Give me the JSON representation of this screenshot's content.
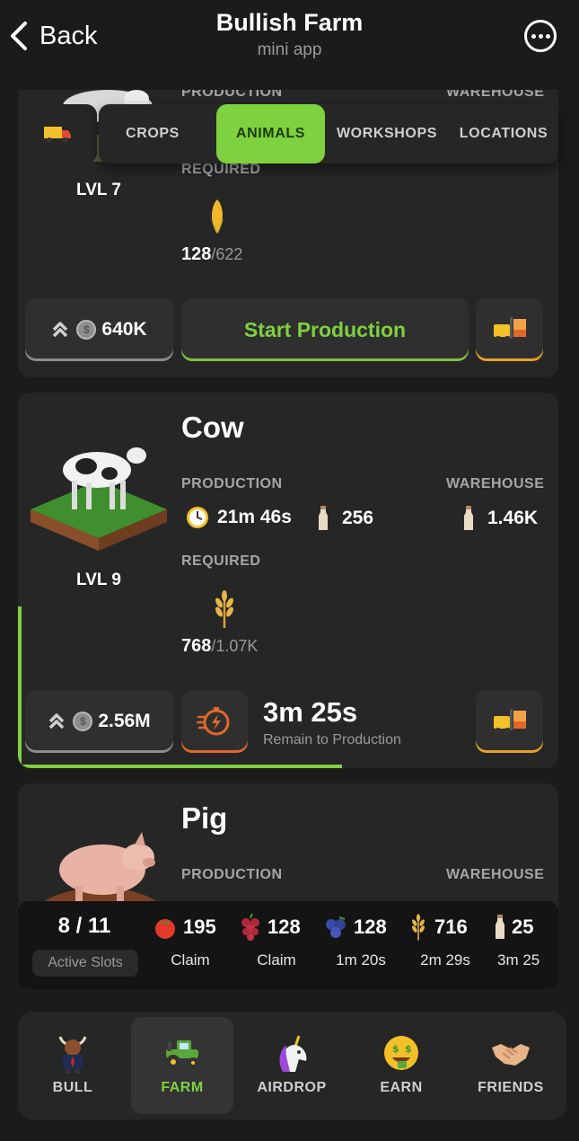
{
  "header": {
    "back_label": "Back",
    "title": "Bullish Farm",
    "subtitle": "mini app"
  },
  "tabs": [
    {
      "label": "CROPS",
      "active": false
    },
    {
      "label": "ANIMALS",
      "active": true
    },
    {
      "label": "WORKSHOPS",
      "active": false
    },
    {
      "label": "LOCATIONS",
      "active": false
    }
  ],
  "cards": [
    {
      "name": "",
      "level": "LVL 7",
      "production_label": "PRODUCTION",
      "warehouse_label": "WAREHOUSE",
      "required_label": "REQUIRED",
      "required_icon": "corn-icon",
      "required_have": "128",
      "required_need": "/622",
      "upgrade_cost": "640K",
      "action_label": "Start Production"
    },
    {
      "name": "Cow",
      "level": "LVL 9",
      "production_label": "PRODUCTION",
      "production_time": "21m 46s",
      "production_amount": "256",
      "warehouse_label": "WAREHOUSE",
      "warehouse_amount": "1.46K",
      "required_label": "REQUIRED",
      "required_icon": "wheat-icon",
      "required_have": "768",
      "required_need": "/1.07K",
      "upgrade_cost": "2.56M",
      "timer": "3m 25s",
      "timer_label": "Remain to Production",
      "progress": 0.6
    },
    {
      "name": "Pig",
      "production_label": "PRODUCTION",
      "warehouse_label": "WAREHOUSE"
    }
  ],
  "slots": {
    "count": "8 / 11",
    "label": "Active Slots",
    "items": [
      {
        "icon": "tomato-icon",
        "amount": "195",
        "status": "Claim"
      },
      {
        "icon": "grapes-icon",
        "amount": "128",
        "status": "Claim"
      },
      {
        "icon": "blueberries-icon",
        "amount": "128",
        "status": "1m 20s"
      },
      {
        "icon": "wheat-icon",
        "amount": "716",
        "status": "2m 29s"
      },
      {
        "icon": "milk-bottle-icon",
        "amount": "25",
        "status": "3m 25"
      }
    ]
  },
  "nav": [
    {
      "label": "BULL",
      "icon": "bull-icon",
      "active": false
    },
    {
      "label": "FARM",
      "icon": "tractor-icon",
      "active": true
    },
    {
      "label": "AIRDROP",
      "icon": "unicorn-icon",
      "active": false
    },
    {
      "label": "EARN",
      "icon": "money-face-icon",
      "active": false
    },
    {
      "label": "FRIENDS",
      "icon": "handshake-icon",
      "active": false
    }
  ],
  "colors": {
    "accent_green": "#7ed13f",
    "orange_edge": "#e6a227",
    "red_edge": "#e2682a",
    "background": "#1b1b1b",
    "card": "#262626"
  }
}
